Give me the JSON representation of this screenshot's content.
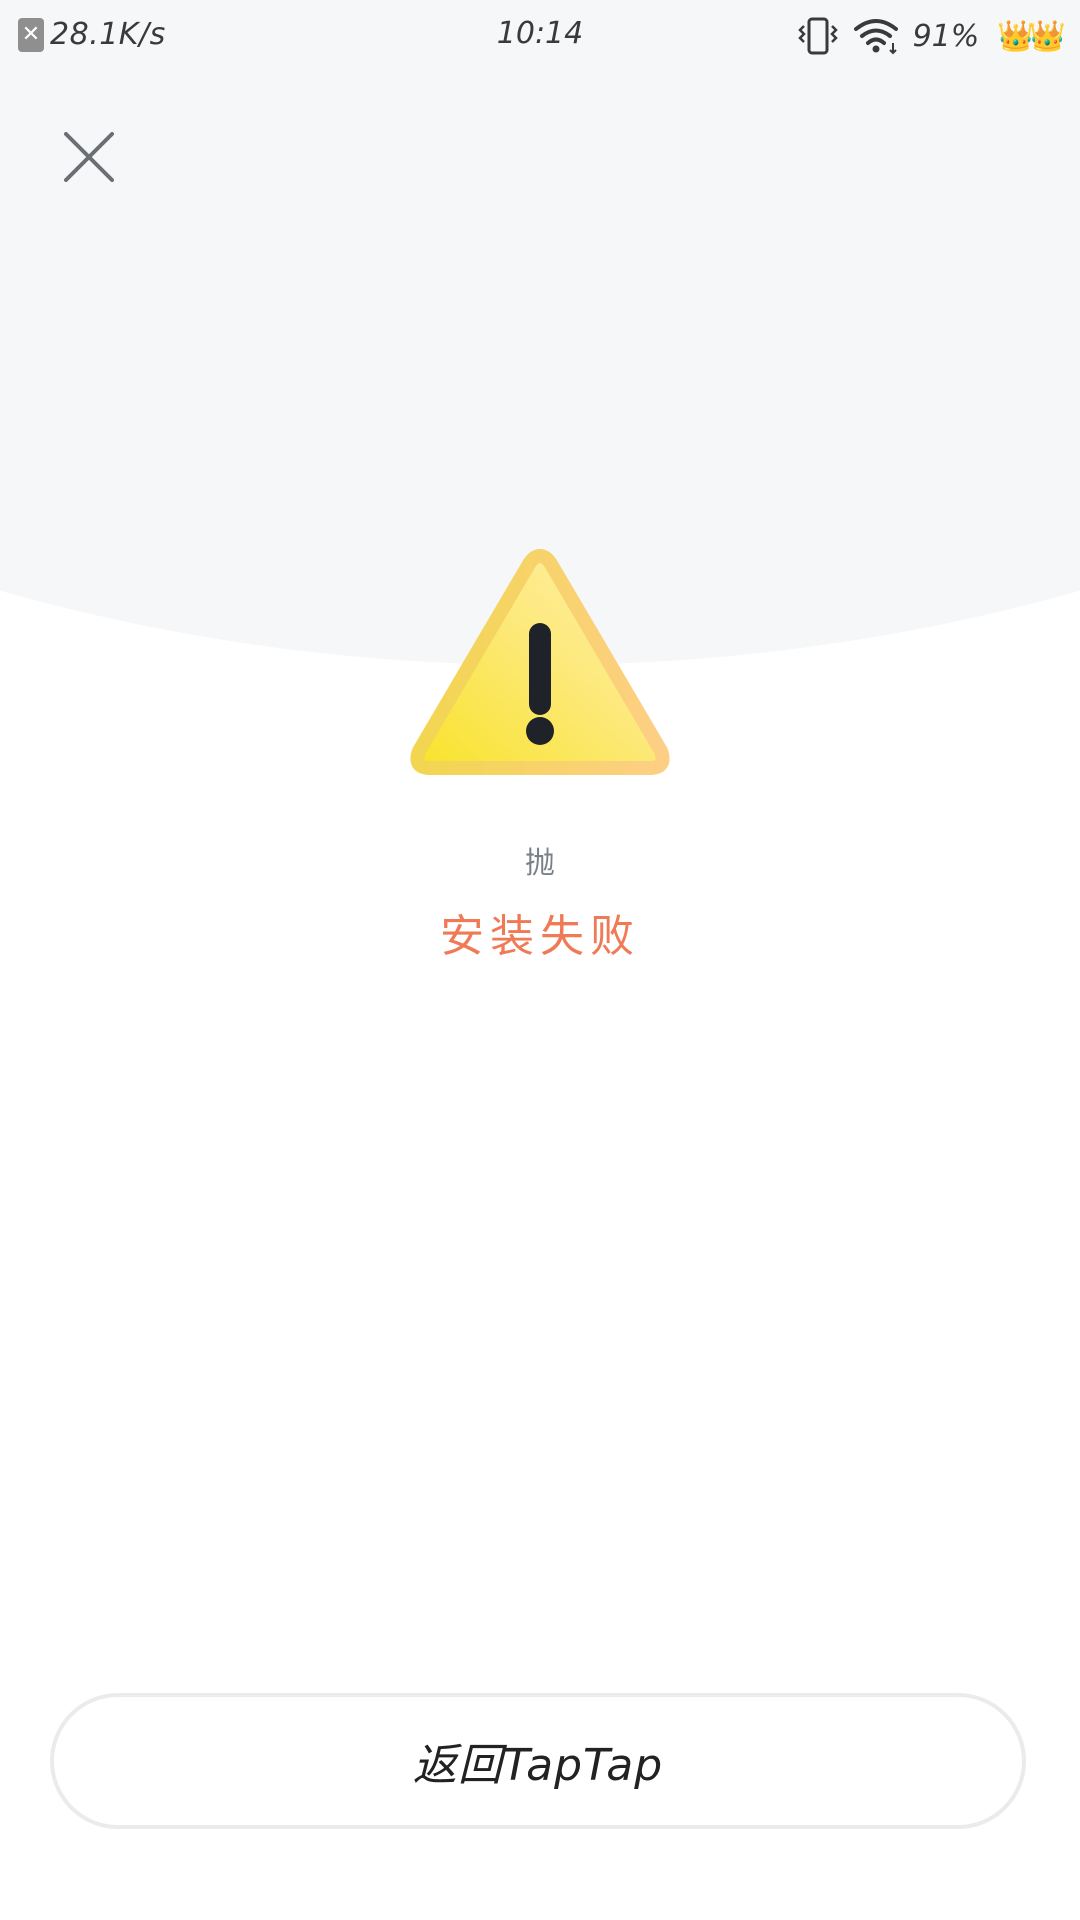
{
  "status_bar": {
    "net_speed": "28.1K/s",
    "time": "10:14",
    "battery": "91%",
    "icons": [
      "sim-error-icon",
      "vibrate-icon",
      "wifi-icon",
      "crown-icon"
    ]
  },
  "header": {
    "close_icon": "close-icon"
  },
  "result": {
    "icon": "warning-icon",
    "sub_label": "抛",
    "title": "安装失败"
  },
  "footer": {
    "return_label": "返回TapTap"
  },
  "colors": {
    "top_background": "#f6f7f8",
    "title": "#f07a55",
    "warning_yellow": "#fbe448",
    "warning_orange": "#fdcf85"
  }
}
